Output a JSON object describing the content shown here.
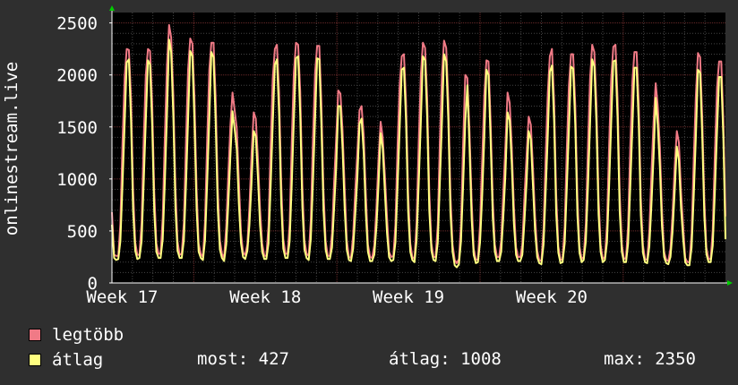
{
  "chart_data": {
    "type": "line",
    "ylabel": "onlinestream.live",
    "xlabel": "",
    "title": "",
    "ylim": [
      0,
      2600
    ],
    "yticks": [
      0,
      500,
      1000,
      1500,
      2000,
      2500
    ],
    "x_tick_labels": [
      "Week 17",
      "Week 18",
      "Week 19",
      "Week 20"
    ],
    "grid": true,
    "legend_position": "bottom-left",
    "series": [
      {
        "name": "legtöbb",
        "color": "#f07a86",
        "values": [
          680,
          270,
          260,
          260,
          570,
          1350,
          1980,
          2250,
          2240,
          1780,
          900,
          390,
          270,
          270,
          580,
          1360,
          2000,
          2250,
          2230,
          1740,
          880,
          380,
          280,
          280,
          630,
          1420,
          2090,
          2480,
          2360,
          1810,
          910,
          400,
          270,
          280,
          580,
          1380,
          2050,
          2350,
          2300,
          1790,
          900,
          380,
          280,
          250,
          590,
          1370,
          2050,
          2310,
          2310,
          1800,
          920,
          410,
          280,
          240,
          540,
          1040,
          1520,
          1830,
          1660,
          1480,
          980,
          480,
          290,
          270,
          370,
          730,
          1250,
          1640,
          1580,
          1190,
          720,
          380,
          260,
          260,
          550,
          1330,
          1960,
          2250,
          2290,
          1830,
          960,
          420,
          280,
          280,
          570,
          1370,
          2020,
          2310,
          2290,
          1840,
          930,
          410,
          280,
          260,
          600,
          1380,
          2020,
          2280,
          2280,
          1740,
          890,
          400,
          260,
          260,
          480,
          960,
          1400,
          1850,
          1820,
          1460,
          920,
          410,
          250,
          240,
          460,
          880,
          1260,
          1660,
          1700,
          1420,
          870,
          370,
          250,
          240,
          360,
          720,
          1190,
          1550,
          1400,
          1040,
          630,
          300,
          250,
          260,
          560,
          1320,
          1900,
          2180,
          2200,
          1750,
          870,
          380,
          250,
          230,
          580,
          1350,
          2000,
          2310,
          2260,
          1790,
          880,
          380,
          250,
          250,
          560,
          1360,
          2010,
          2330,
          2260,
          1750,
          860,
          370,
          220,
          190,
          230,
          560,
          1340,
          2000,
          1970,
          1460,
          790,
          330,
          220,
          230,
          560,
          1180,
          1800,
          2140,
          2130,
          1550,
          800,
          370,
          250,
          250,
          410,
          880,
          1320,
          1830,
          1730,
          1310,
          730,
          340,
          250,
          250,
          370,
          830,
          1240,
          1600,
          1520,
          1100,
          640,
          310,
          220,
          210,
          520,
          1210,
          1820,
          2180,
          2250,
          1740,
          850,
          350,
          220,
          230,
          540,
          1270,
          1900,
          2200,
          2200,
          1710,
          820,
          350,
          230,
          250,
          570,
          1320,
          1960,
          2290,
          2220,
          1730,
          830,
          370,
          230,
          250,
          560,
          1320,
          1960,
          2270,
          2290,
          1780,
          870,
          370,
          230,
          240,
          550,
          1310,
          1940,
          2220,
          2220,
          1720,
          820,
          360,
          230,
          220,
          500,
          1040,
          1540,
          1920,
          1700,
          1300,
          700,
          300,
          220,
          210,
          330,
          660,
          1120,
          1460,
          1350,
          880,
          540,
          240,
          200,
          200,
          480,
          1190,
          1790,
          2210,
          2170,
          1610,
          800,
          340,
          230,
          230,
          510,
          1250,
          1880,
          2130,
          2130,
          1580,
          640
        ]
      },
      {
        "name": "átlag",
        "color": "#ffff80",
        "values": [
          560,
          240,
          220,
          230,
          400,
          950,
          1540,
          2120,
          2150,
          1560,
          700,
          310,
          230,
          240,
          400,
          950,
          1560,
          2140,
          2100,
          1520,
          690,
          300,
          240,
          240,
          420,
          980,
          1610,
          2340,
          2220,
          1610,
          720,
          310,
          240,
          240,
          410,
          950,
          1570,
          2230,
          2180,
          1560,
          710,
          300,
          240,
          220,
          410,
          960,
          1580,
          2220,
          2170,
          1580,
          720,
          320,
          240,
          210,
          370,
          760,
          1230,
          1650,
          1480,
          1280,
          760,
          380,
          250,
          230,
          310,
          560,
          970,
          1460,
          1410,
          1010,
          560,
          300,
          230,
          230,
          380,
          930,
          1520,
          2100,
          2150,
          1630,
          760,
          330,
          240,
          240,
          400,
          960,
          1570,
          2160,
          2180,
          1620,
          730,
          320,
          240,
          220,
          420,
          960,
          1580,
          2160,
          2150,
          1530,
          700,
          320,
          230,
          230,
          340,
          710,
          1120,
          1700,
          1700,
          1290,
          720,
          320,
          220,
          210,
          330,
          650,
          1010,
          1530,
          1580,
          1250,
          680,
          300,
          210,
          210,
          270,
          540,
          940,
          1440,
          1300,
          880,
          480,
          250,
          210,
          220,
          390,
          930,
          1480,
          2050,
          2070,
          1570,
          690,
          300,
          220,
          200,
          410,
          950,
          1550,
          2180,
          2140,
          1600,
          700,
          310,
          220,
          210,
          390,
          960,
          1560,
          2200,
          2130,
          1560,
          680,
          300,
          170,
          150,
          180,
          400,
          940,
          1550,
          1900,
          1310,
          620,
          270,
          190,
          200,
          390,
          840,
          1390,
          2050,
          2000,
          1370,
          630,
          300,
          210,
          210,
          300,
          640,
          1040,
          1640,
          1560,
          1140,
          570,
          270,
          210,
          210,
          270,
          600,
          980,
          1460,
          1380,
          930,
          500,
          250,
          190,
          180,
          370,
          860,
          1410,
          2030,
          2090,
          1550,
          670,
          290,
          190,
          200,
          380,
          900,
          1470,
          2080,
          2060,
          1520,
          650,
          290,
          200,
          220,
          400,
          930,
          1520,
          2150,
          2080,
          1540,
          660,
          300,
          200,
          220,
          390,
          930,
          1530,
          2130,
          2140,
          1590,
          690,
          300,
          200,
          200,
          380,
          920,
          1500,
          2070,
          2070,
          1530,
          650,
          290,
          200,
          190,
          350,
          740,
          1210,
          1780,
          1520,
          1110,
          550,
          250,
          190,
          180,
          250,
          490,
          880,
          1310,
          1180,
          720,
          420,
          200,
          170,
          170,
          340,
          840,
          1390,
          2050,
          2020,
          1430,
          640,
          280,
          200,
          200,
          360,
          880,
          1460,
          1980,
          1980,
          1410,
          420
        ]
      }
    ]
  },
  "legend": {
    "max_label": "legtöbb",
    "avg_label": "átlag",
    "max_color": "#f07a86",
    "avg_color": "#ffff80"
  },
  "stats": {
    "current": "most: 427",
    "average": "átlag: 1008",
    "maximum": "max: 2350"
  },
  "theme": {
    "background": "#2f2f2f",
    "plot_background": "#000000",
    "grid_minor": "#444444",
    "grid_major": "#6a2a2a",
    "axis_arrow": "#00cc00"
  }
}
